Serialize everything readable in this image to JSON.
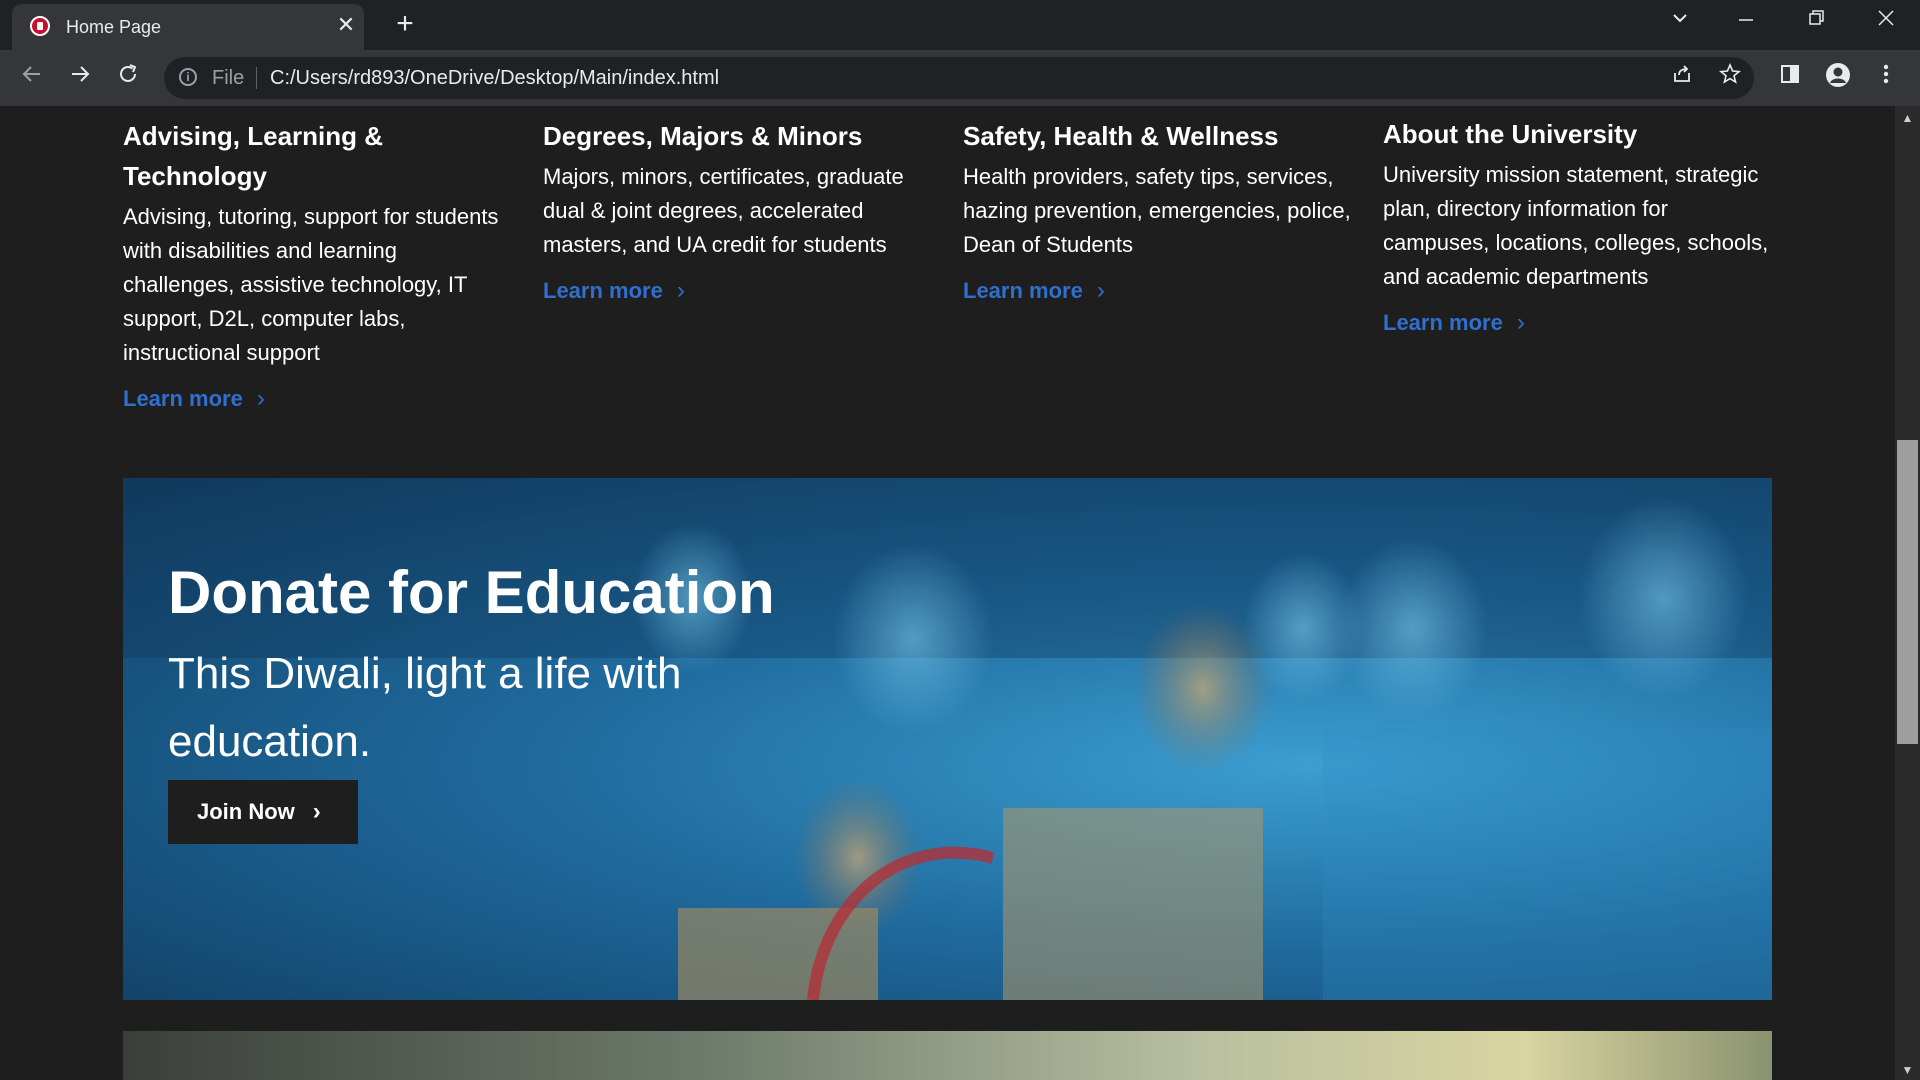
{
  "browser": {
    "tab_title": "Home Page",
    "url_scheme": "File",
    "url": "C:/Users/rd893/OneDrive/Desktop/Main/index.html"
  },
  "info_columns": [
    {
      "title": "Advising, Learning & Technology",
      "description": "Advising, tutoring, support for students with disabilities and learning challenges, assistive technology, IT support, D2L, computer labs, instructional support",
      "link": "Learn more"
    },
    {
      "title": "Degrees, Majors & Minors",
      "description": "Majors, minors, certificates, graduate dual & joint degrees, accelerated masters, and UA credit for students",
      "link": "Learn more"
    },
    {
      "title": "Safety, Health & Wellness",
      "description": "Health providers, safety tips, services, hazing prevention, emergencies, police, Dean of Students",
      "link": "Learn more"
    },
    {
      "title": "About the University",
      "description": "University mission statement, strategic plan, directory information for campuses, locations, colleges, schools, and academic departments",
      "link": "Learn more"
    }
  ],
  "banner": {
    "title": "Donate for Education",
    "subtitle": "This Diwali, light a life with education.",
    "button": "Join Now"
  },
  "colors": {
    "page_bg": "#1e1e1e",
    "link": "#2f6fce",
    "banner_tint": "#2a8fc7"
  }
}
